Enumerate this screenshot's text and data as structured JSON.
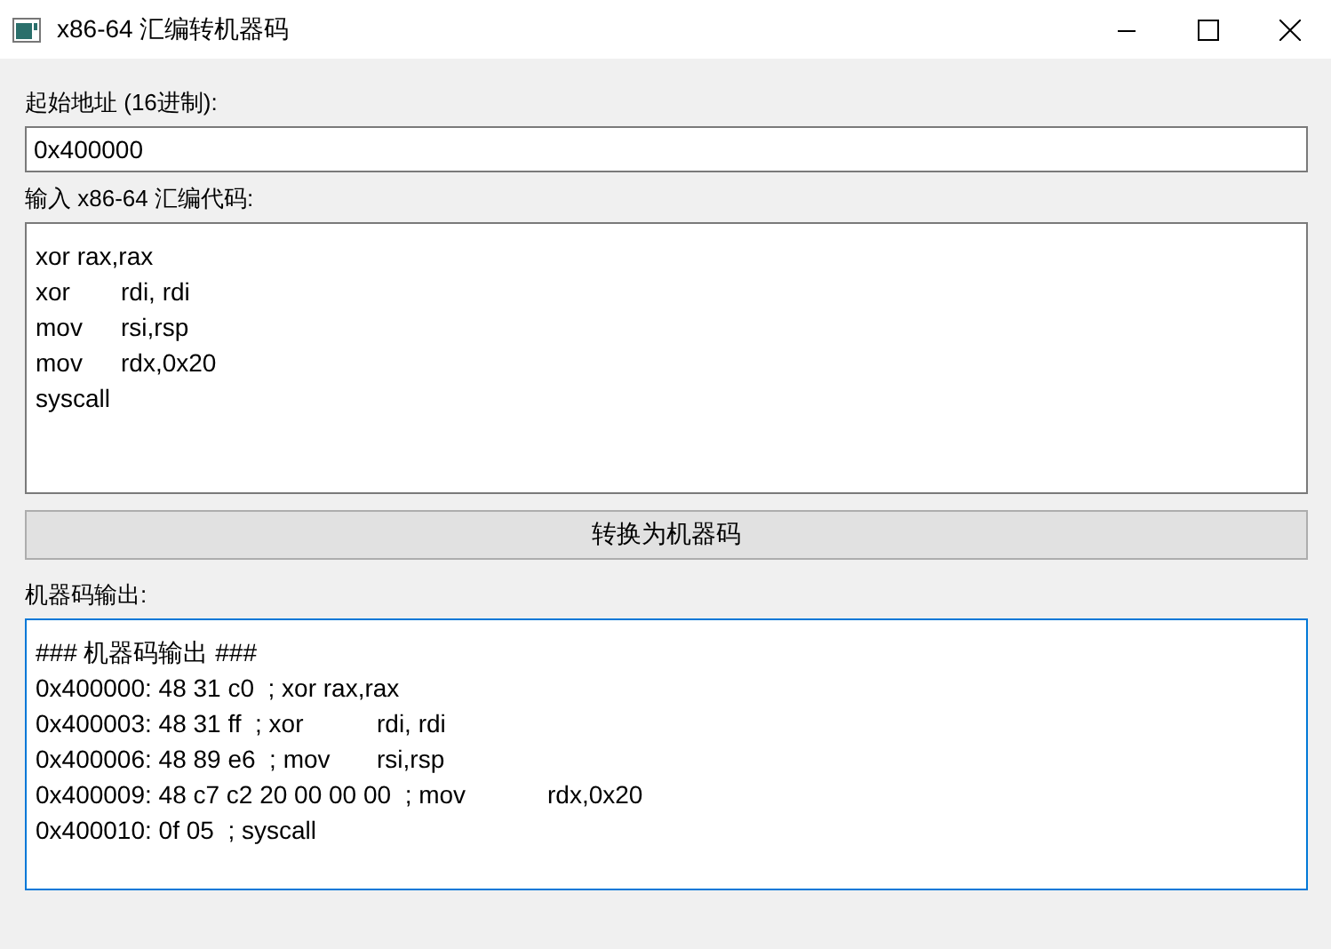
{
  "window": {
    "title": "x86-64 汇编转机器码"
  },
  "address": {
    "label": "起始地址 (16进制):",
    "value": "0x400000"
  },
  "input": {
    "label": "输入 x86-64 汇编代码:",
    "value": "xor rax,rax\nxor\trdi, rdi\nmov\trsi,rsp\nmov\trdx,0x20\nsyscall"
  },
  "convert_button": "转换为机器码",
  "output": {
    "label": "机器码输出:",
    "focused": true,
    "value": "### 机器码输出 ###\n0x400000: 48 31 c0  ; xor rax,rax\n0x400003: 48 31 ff  ; xor\trdi, rdi\n0x400006: 48 89 e6  ; mov\trsi,rsp\n0x400009: 48 c7 c2 20 00 00 00  ; mov\trdx,0x20\n0x400010: 0f 05  ; syscall"
  }
}
